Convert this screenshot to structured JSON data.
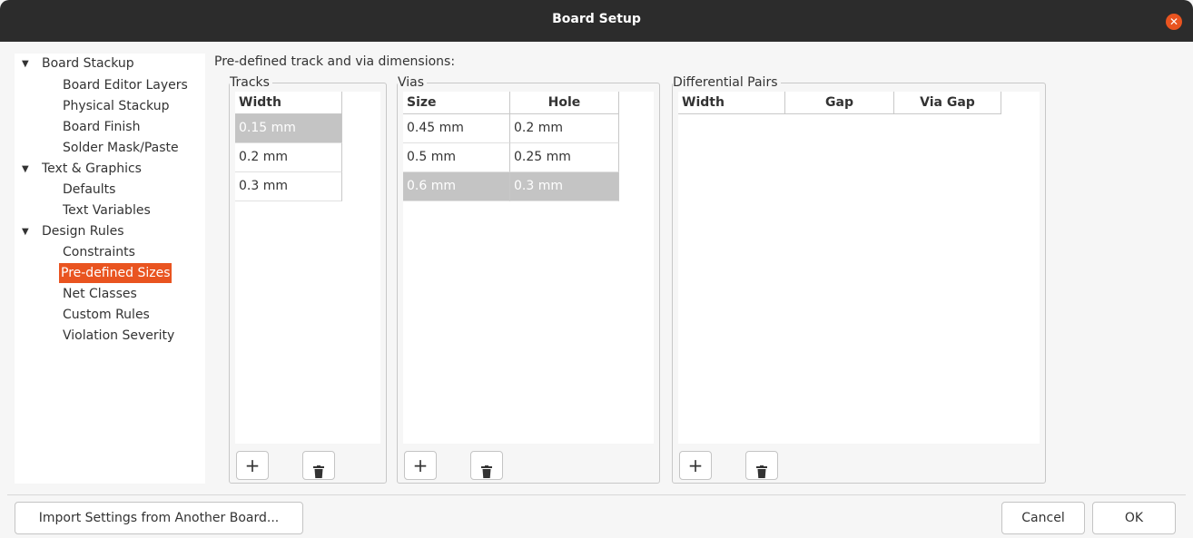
{
  "window": {
    "title": "Board Setup"
  },
  "sidebar": {
    "items": [
      {
        "label": "Board Stackup",
        "level": 0,
        "expanded": true
      },
      {
        "label": "Board Editor Layers",
        "level": 1
      },
      {
        "label": "Physical Stackup",
        "level": 1
      },
      {
        "label": "Board Finish",
        "level": 1
      },
      {
        "label": "Solder Mask/Paste",
        "level": 1
      },
      {
        "label": "Text & Graphics",
        "level": 0,
        "expanded": true
      },
      {
        "label": "Defaults",
        "level": 1
      },
      {
        "label": "Text Variables",
        "level": 1
      },
      {
        "label": "Design Rules",
        "level": 0,
        "expanded": true
      },
      {
        "label": "Constraints",
        "level": 1
      },
      {
        "label": "Pre-defined Sizes",
        "level": 1,
        "selected": true
      },
      {
        "label": "Net Classes",
        "level": 1
      },
      {
        "label": "Custom Rules",
        "level": 1
      },
      {
        "label": "Violation Severity",
        "level": 1
      }
    ],
    "expand_glyph": "▼"
  },
  "main": {
    "heading": "Pre-defined track and via dimensions:",
    "tracks": {
      "title": "Tracks",
      "columns": [
        "Width"
      ],
      "rows": [
        [
          "0.15 mm"
        ],
        [
          "0.2 mm"
        ],
        [
          "0.3 mm"
        ]
      ],
      "selected_row": 0
    },
    "vias": {
      "title": "Vias",
      "columns": [
        "Size",
        "Hole"
      ],
      "rows": [
        [
          "0.45 mm",
          "0.2 mm"
        ],
        [
          "0.5 mm",
          "0.25 mm"
        ],
        [
          "0.6 mm",
          "0.3 mm"
        ]
      ],
      "selected_row": 2
    },
    "diff_pairs": {
      "title": "Differential Pairs",
      "columns": [
        "Width",
        "Gap",
        "Via Gap"
      ],
      "rows": []
    },
    "add_glyph": "+",
    "icons": {
      "add": "plus-icon",
      "delete": "trash-icon",
      "close": "close-icon"
    }
  },
  "footer": {
    "import_label": "Import Settings from Another Board...",
    "cancel_label": "Cancel",
    "ok_label": "OK"
  },
  "colors": {
    "accent": "#e95420",
    "titlebar": "#2c2c2c",
    "selection": "#c4c4c4"
  }
}
